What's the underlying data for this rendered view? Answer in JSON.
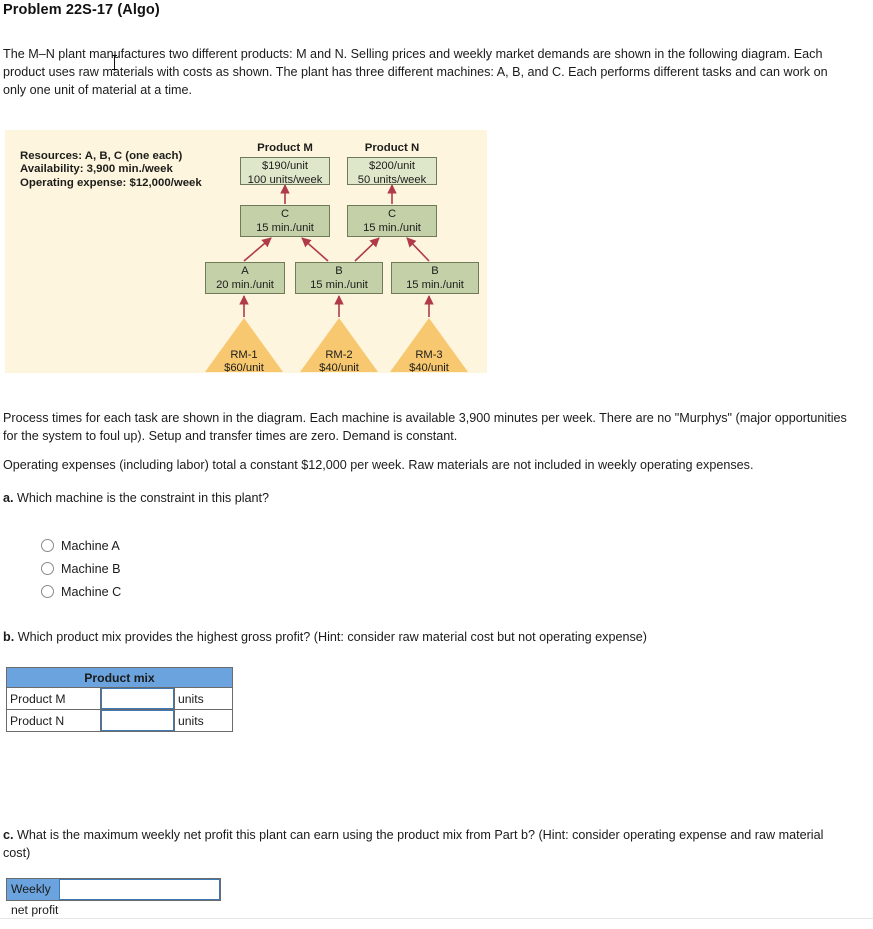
{
  "page": {
    "title": "Problem 22S-17 (Algo)",
    "intro": "The M–N plant manufactures two different products: M and N. Selling prices and weekly market demands are shown in the following diagram. Each product uses raw materials with costs as shown. The plant has three different machines: A, B, and C. Each performs different tasks and can work on only one unit of material at a time.",
    "paragraph_process": "Process times for each task are shown in the diagram. Each machine is available 3,900 minutes per week. There are no \"Murphys\" (major opportunities for the system to foul up). Setup and transfer times are zero. Demand is constant.",
    "paragraph_expenses": "Operating expenses (including labor) total a constant $12,000 per week. Raw materials are not included in weekly operating expenses."
  },
  "diagram": {
    "legend": {
      "resources": "Resources:  A, B, C (one each)",
      "availability": "Availability: 3,900 min./week",
      "operating_expense": "Operating expense:  $12,000/week"
    },
    "products": [
      {
        "name": "Product M",
        "price": "$190/unit",
        "demand": "100 units/week"
      },
      {
        "name": "Product N",
        "price": "$200/unit",
        "demand": "50 units/week"
      }
    ],
    "top_machines": [
      {
        "machine": "C",
        "time": "15 min./unit"
      },
      {
        "machine": "C",
        "time": "15 min./unit"
      }
    ],
    "bottom_machines": [
      {
        "machine": "A",
        "time": "20 min./unit"
      },
      {
        "machine": "B",
        "time": "15 min./unit"
      },
      {
        "machine": "B",
        "time": "15 min./unit"
      }
    ],
    "raw_materials": [
      {
        "name": "RM-1",
        "cost": "$60/unit"
      },
      {
        "name": "RM-2",
        "cost": "$40/unit"
      },
      {
        "name": "RM-3",
        "cost": "$40/unit"
      }
    ],
    "colors": {
      "background": "#fdf5dd",
      "product_box": "#dfe7cb",
      "machine_box": "#c3d0a8",
      "raw_material": "#f8c870",
      "arrow": "#b03a4a",
      "box_border": "#6f7a58"
    }
  },
  "part_a": {
    "lead": "a.",
    "question": "Which machine is the constraint in this plant?",
    "options": [
      {
        "label": "Machine A",
        "selected": false
      },
      {
        "label": "Machine B",
        "selected": false
      },
      {
        "label": "Machine C",
        "selected": false
      }
    ]
  },
  "part_b": {
    "lead": "b.",
    "question": "Which product mix provides the highest gross profit? (Hint: consider raw material cost but not operating expense)",
    "table": {
      "header": "Product mix",
      "rows": [
        {
          "label": "Product M",
          "value": "",
          "unit": "units"
        },
        {
          "label": "Product N",
          "value": "",
          "unit": "units"
        }
      ]
    }
  },
  "part_c": {
    "lead": "c.",
    "question": "What is the maximum weekly net profit this plant can earn using the product mix from Part b? (Hint: consider operating expense and raw material cost)",
    "field": {
      "label": "Weekly net profit",
      "value": ""
    }
  },
  "theme": {
    "header_blue": "#6aa3dd",
    "input_border": "#3f79b5"
  }
}
